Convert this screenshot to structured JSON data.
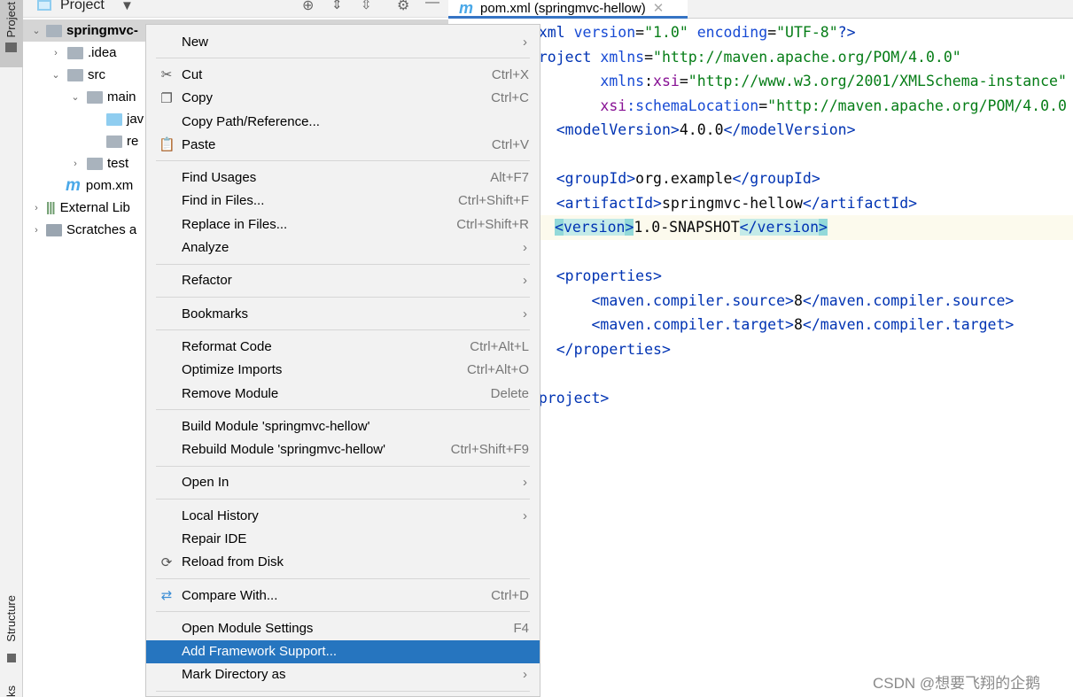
{
  "sidebar": {
    "project_label": "Project",
    "structure_label": "Structure",
    "bookmarks_label": "ks"
  },
  "panel": {
    "title": "Project"
  },
  "tree": [
    {
      "label": "springmvc-",
      "chev": "⌄",
      "icon": "module",
      "sel": true,
      "indent": 0
    },
    {
      "label": ".idea",
      "chev": "›",
      "icon": "folder",
      "indent": 1
    },
    {
      "label": "src",
      "chev": "⌄",
      "icon": "folder",
      "indent": 1
    },
    {
      "label": "main",
      "chev": "⌄",
      "icon": "folder",
      "indent": 2
    },
    {
      "label": "jav",
      "chev": "",
      "icon": "folder-blue",
      "indent": 3
    },
    {
      "label": "re",
      "chev": "",
      "icon": "folder-res",
      "indent": 3
    },
    {
      "label": "test",
      "chev": "›",
      "icon": "folder",
      "indent": 2
    },
    {
      "label": "pom.xm",
      "chev": "",
      "icon": "maven",
      "indent": 1
    },
    {
      "label": "External Lib",
      "chev": "›",
      "icon": "library",
      "indent": 0
    },
    {
      "label": "Scratches a",
      "chev": "›",
      "icon": "scratches",
      "indent": 0
    }
  ],
  "tab": {
    "label": "pom.xml (springmvc-hellow)",
    "icon": "m"
  },
  "code": [
    [
      [
        "tag",
        "<?xml "
      ],
      [
        "attr",
        "version"
      ],
      [
        "txt",
        "="
      ],
      [
        "val",
        "\"1.0\" "
      ],
      [
        "attr",
        "encoding"
      ],
      [
        "txt",
        "="
      ],
      [
        "val",
        "\"UTF-8\""
      ],
      [
        "tag",
        "?>"
      ]
    ],
    [
      [
        "tag",
        "<project "
      ],
      [
        "attr",
        "xmlns"
      ],
      [
        "txt",
        "="
      ],
      [
        "val",
        "\"http://maven.apache.org/POM/4.0.0\""
      ]
    ],
    [
      [
        "txt",
        "         "
      ],
      [
        "attr",
        "xmlns"
      ],
      [
        "txt",
        ":"
      ],
      [
        "ns",
        "xsi"
      ],
      [
        "txt",
        "="
      ],
      [
        "val",
        "\"http://www.w3.org/2001/XMLSchema-instance\""
      ]
    ],
    [
      [
        "txt",
        "         "
      ],
      [
        "ns",
        "xsi"
      ],
      [
        "attr",
        ":schemaLocation"
      ],
      [
        "txt",
        "="
      ],
      [
        "val",
        "\"http://maven.apache.org/POM/4.0.0"
      ]
    ],
    [
      [
        "txt",
        "    "
      ],
      [
        "tag",
        "<modelVersion>"
      ],
      [
        "txt",
        "4.0.0"
      ],
      [
        "tag",
        "</modelVersion>"
      ]
    ],
    [],
    [
      [
        "txt",
        "    "
      ],
      [
        "tag",
        "<groupId>"
      ],
      [
        "txt",
        "org.example"
      ],
      [
        "tag",
        "</groupId>"
      ]
    ],
    [
      [
        "txt",
        "    "
      ],
      [
        "tag",
        "<artifactId>"
      ],
      [
        "txt",
        "springmvc-hellow"
      ],
      [
        "tag",
        "</artifactId>"
      ]
    ],
    [
      [
        "mb",
        "<"
      ],
      [
        "m",
        "version"
      ],
      [
        "mb",
        ">"
      ],
      [
        "txt",
        "1.0-SNAPSHOT"
      ],
      [
        "m",
        "</version"
      ],
      [
        "mb",
        ">"
      ]
    ],
    [],
    [
      [
        "txt",
        "    "
      ],
      [
        "tag",
        "<properties>"
      ]
    ],
    [
      [
        "txt",
        "        "
      ],
      [
        "tag",
        "<maven.compiler.source>"
      ],
      [
        "txt",
        "8"
      ],
      [
        "tag",
        "</maven.compiler.source>"
      ]
    ],
    [
      [
        "txt",
        "        "
      ],
      [
        "tag",
        "<maven.compiler.target>"
      ],
      [
        "txt",
        "8"
      ],
      [
        "tag",
        "</maven.compiler.target>"
      ]
    ],
    [
      [
        "txt",
        "    "
      ],
      [
        "tag",
        "</properties>"
      ]
    ],
    [],
    [
      [
        "tag",
        "</project>"
      ]
    ]
  ],
  "menu": [
    {
      "label": "New",
      "sub": true
    },
    {
      "sep": true
    },
    {
      "label": "Cut",
      "shortcut": "Ctrl+X",
      "icon": "scissors"
    },
    {
      "label": "Copy",
      "shortcut": "Ctrl+C",
      "icon": "copy"
    },
    {
      "label": "Copy Path/Reference..."
    },
    {
      "label": "Paste",
      "shortcut": "Ctrl+V",
      "icon": "clipboard"
    },
    {
      "sep": true
    },
    {
      "label": "Find Usages",
      "shortcut": "Alt+F7"
    },
    {
      "label": "Find in Files...",
      "shortcut": "Ctrl+Shift+F"
    },
    {
      "label": "Replace in Files...",
      "shortcut": "Ctrl+Shift+R"
    },
    {
      "label": "Analyze",
      "sub": true
    },
    {
      "sep": true
    },
    {
      "label": "Refactor",
      "sub": true
    },
    {
      "sep": true
    },
    {
      "label": "Bookmarks",
      "sub": true
    },
    {
      "sep": true
    },
    {
      "label": "Reformat Code",
      "shortcut": "Ctrl+Alt+L"
    },
    {
      "label": "Optimize Imports",
      "shortcut": "Ctrl+Alt+O"
    },
    {
      "label": "Remove Module",
      "shortcut": "Delete"
    },
    {
      "sep": true
    },
    {
      "label": "Build Module 'springmvc-hellow'"
    },
    {
      "label": "Rebuild Module 'springmvc-hellow'",
      "shortcut": "Ctrl+Shift+F9"
    },
    {
      "sep": true
    },
    {
      "label": "Open In",
      "sub": true
    },
    {
      "sep": true
    },
    {
      "label": "Local History",
      "sub": true
    },
    {
      "label": "Repair IDE"
    },
    {
      "label": "Reload from Disk",
      "icon": "reload"
    },
    {
      "sep": true
    },
    {
      "label": "Compare With...",
      "shortcut": "Ctrl+D",
      "icon": "compare"
    },
    {
      "sep": true
    },
    {
      "label": "Open Module Settings",
      "shortcut": "F4"
    },
    {
      "label": "Add Framework Support...",
      "highlighted": true
    },
    {
      "label": "Mark Directory as",
      "sub": true
    },
    {
      "sep": true
    }
  ],
  "watermark": "CSDN @想要飞翔的企鹅",
  "colors": {
    "selection": "#2675bf",
    "tab_underline": "#3574c4",
    "current_line": "#fcfaed",
    "tag": "#0033b3",
    "value": "#067d17"
  }
}
